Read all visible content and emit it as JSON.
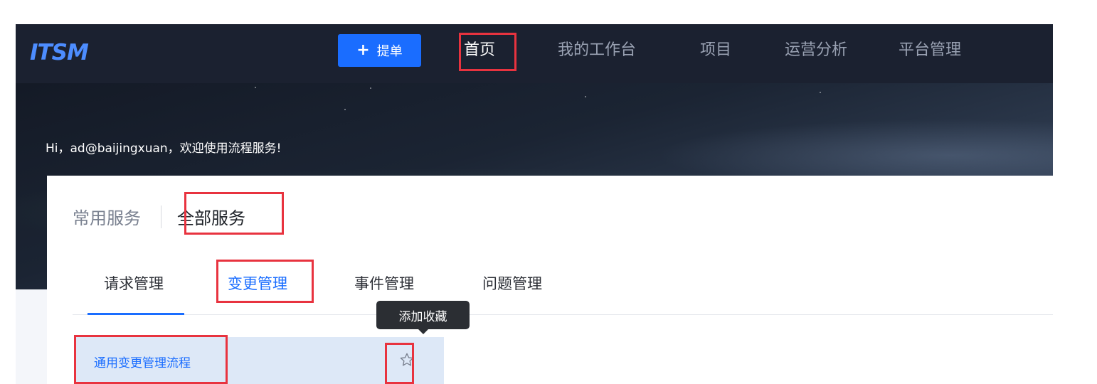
{
  "app": {
    "logo_text": "ITSM"
  },
  "topnav": {
    "create_button": {
      "icon": "plus-icon",
      "label": "提单"
    },
    "items": [
      {
        "label": "首页",
        "active": true
      },
      {
        "label": "我的工作台",
        "active": false
      },
      {
        "label": "项目",
        "active": false
      },
      {
        "label": "运营分析",
        "active": false
      },
      {
        "label": "平台管理",
        "active": false
      }
    ]
  },
  "banner": {
    "greeting": "Hi，ad@baijingxuan，欢迎使用流程服务!"
  },
  "services": {
    "mode_tabs": [
      {
        "label": "常用服务",
        "active": false
      },
      {
        "label": "全部服务",
        "active": true
      }
    ],
    "category_tabs": [
      {
        "label": "请求管理",
        "active": false,
        "underlined": true
      },
      {
        "label": "变更管理",
        "active": true
      },
      {
        "label": "事件管理",
        "active": false
      },
      {
        "label": "问题管理",
        "active": false
      }
    ],
    "list": [
      {
        "name": "通用变更管理流程",
        "favorite_icon": "star-outline-icon",
        "favorited": false
      }
    ],
    "tooltip": "添加收藏"
  },
  "colors": {
    "accent": "#1a6dff",
    "nav_background": "#1b2130",
    "highlight_box": "#e8333f",
    "selected_row": "#dde8f7"
  }
}
